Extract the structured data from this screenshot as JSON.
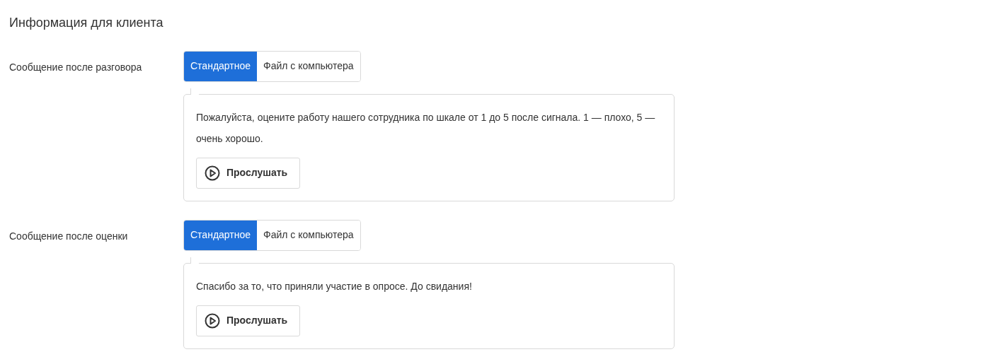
{
  "title": "Информация для клиента",
  "sections": [
    {
      "label": "Сообщение после разговора",
      "tabs": [
        {
          "label": "Стандартное",
          "selected": true
        },
        {
          "label": "Файл с компьютера",
          "selected": false
        }
      ],
      "message": "Пожалуйста, оцените работу нашего сотрудника по шкале от 1 до 5 после сигнала. 1 — плохо, 5 — очень хорошо.",
      "play_button": "Прослушать"
    },
    {
      "label": "Сообщение после оценки",
      "tabs": [
        {
          "label": "Стандартное",
          "selected": true
        },
        {
          "label": "Файл с компьютера",
          "selected": false
        }
      ],
      "message": "Спасибо за то, что приняли участие в опросе. До свидания!",
      "play_button": "Прослушать"
    }
  ]
}
